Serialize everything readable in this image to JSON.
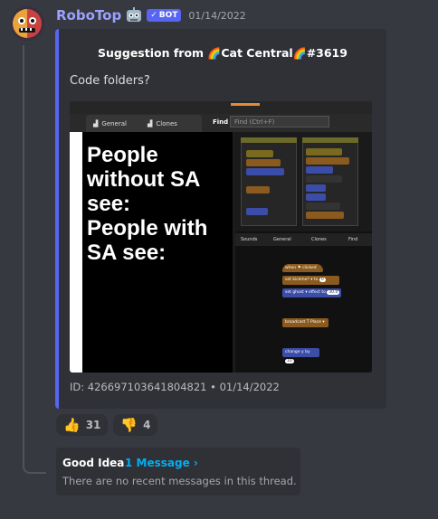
{
  "message": {
    "username": "RoboTop",
    "bot_badge": "BOT",
    "timestamp": "01/14/2022"
  },
  "embed": {
    "title_prefix": "Suggestion from",
    "title_server": "Cat Central",
    "title_suffix": "#3619",
    "description": "Code folders?",
    "footer": "ID: 426697103641804821 • 01/14/2022",
    "accent_color": "#5865f2",
    "screenshot": {
      "tab_general": "General",
      "tab_clones": "Clones",
      "find_label": "Find",
      "find_placeholder": "Find (Ctrl+F)",
      "big_text_line1": "People",
      "big_text_line2": "without SA",
      "big_text_line3": "see:",
      "big_text_line4": "People with",
      "big_text_line5": "SA see:",
      "right_tab_sounds": "Sounds",
      "right_tab_general": "General",
      "right_tab_clones": "Clones",
      "right_find": "Find",
      "block_when_clicked": "when",
      "block_clicked": "clicked",
      "block_set": "set",
      "block_var": "kickme?",
      "block_to": "to",
      "block_to_val": "0",
      "block_set2": "set",
      "block_ghost": "ghost",
      "block_effect": "effect to",
      "block_effect_val": "30.0",
      "block_broadcast": "broadcast",
      "block_broadcast_val": "T Place",
      "block_change": "change y by",
      "block_change_val": "10"
    }
  },
  "reactions": [
    {
      "emoji": "👍",
      "count": "31"
    },
    {
      "emoji": "👎",
      "count": "4"
    }
  ],
  "thread": {
    "name": "Good Idea",
    "count": "1 Message ›",
    "empty_text": "There are no recent messages in this thread."
  }
}
